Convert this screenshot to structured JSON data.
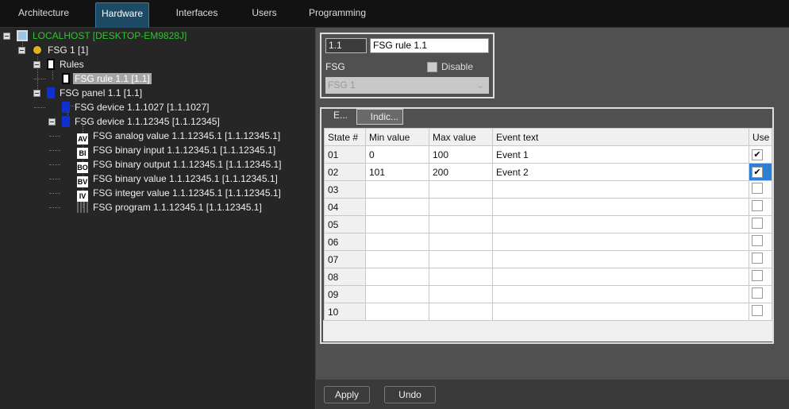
{
  "tabs": [
    "Architecture",
    "Hardware",
    "Interfaces",
    "Users",
    "Programming"
  ],
  "active_tab": "Hardware",
  "tree": [
    {
      "label": "LOCALHOST [DESKTOP-EM9828J]",
      "icon": "computer-icon"
    },
    {
      "label": "FSG 1 [1]",
      "icon": "fsg-icon"
    },
    {
      "label": "Rules",
      "icon": "calculator-icon"
    },
    {
      "label": "FSG rule 1.1 [1.1]",
      "icon": "calculator-icon",
      "selected": true
    },
    {
      "label": "FSG panel 1.1 [1.1]",
      "icon": "panel-icon"
    },
    {
      "label": "FSG device 1.1.1027 [1.1.1027]",
      "icon": "chip-icon"
    },
    {
      "label": "FSG device 1.1.12345 [1.1.12345]",
      "icon": "chip-icon"
    },
    {
      "label": "FSG analog value 1.1.12345.1 [1.1.12345.1]",
      "icon": "analog-value-icon",
      "glyph": "AV"
    },
    {
      "label": "FSG binary input 1.1.12345.1 [1.1.12345.1]",
      "icon": "binary-input-icon",
      "glyph": "BI"
    },
    {
      "label": "FSG binary output 1.1.12345.1 [1.1.12345.1]",
      "icon": "binary-output-icon",
      "glyph": "BO"
    },
    {
      "label": "FSG binary value 1.1.12345.1 [1.1.12345.1]",
      "icon": "binary-value-icon",
      "glyph": "BV"
    },
    {
      "label": "FSG integer value 1.1.12345.1 [1.1.12345.1]",
      "icon": "integer-value-icon",
      "glyph": "IV"
    },
    {
      "label": "FSG program 1.1.12345.1 [1.1.12345.1]",
      "icon": "program-icon"
    }
  ],
  "props": {
    "id": "1.1",
    "name": "FSG rule 1.1",
    "fsg_label": "FSG",
    "fsg_value": "FSG 1",
    "disable_label": "Disable",
    "disabled": false
  },
  "grid_tabs": [
    "E...",
    "Indic..."
  ],
  "columns": [
    "State #",
    "Min value",
    "Max value",
    "Event text",
    "Use"
  ],
  "rows": [
    {
      "state": "01",
      "min": "0",
      "max": "100",
      "event": "Event 1",
      "use": true
    },
    {
      "state": "02",
      "min": "101",
      "max": "200",
      "event": "Event 2",
      "use": true
    },
    {
      "state": "03",
      "min": "",
      "max": "",
      "event": "",
      "use": false
    },
    {
      "state": "04",
      "min": "",
      "max": "",
      "event": "",
      "use": false
    },
    {
      "state": "05",
      "min": "",
      "max": "",
      "event": "",
      "use": false
    },
    {
      "state": "06",
      "min": "",
      "max": "",
      "event": "",
      "use": false
    },
    {
      "state": "07",
      "min": "",
      "max": "",
      "event": "",
      "use": false
    },
    {
      "state": "08",
      "min": "",
      "max": "",
      "event": "",
      "use": false
    },
    {
      "state": "09",
      "min": "",
      "max": "",
      "event": "",
      "use": false
    },
    {
      "state": "10",
      "min": "",
      "max": "",
      "event": "",
      "use": false
    }
  ],
  "buttons": {
    "apply": "Apply",
    "undo": "Undo"
  }
}
